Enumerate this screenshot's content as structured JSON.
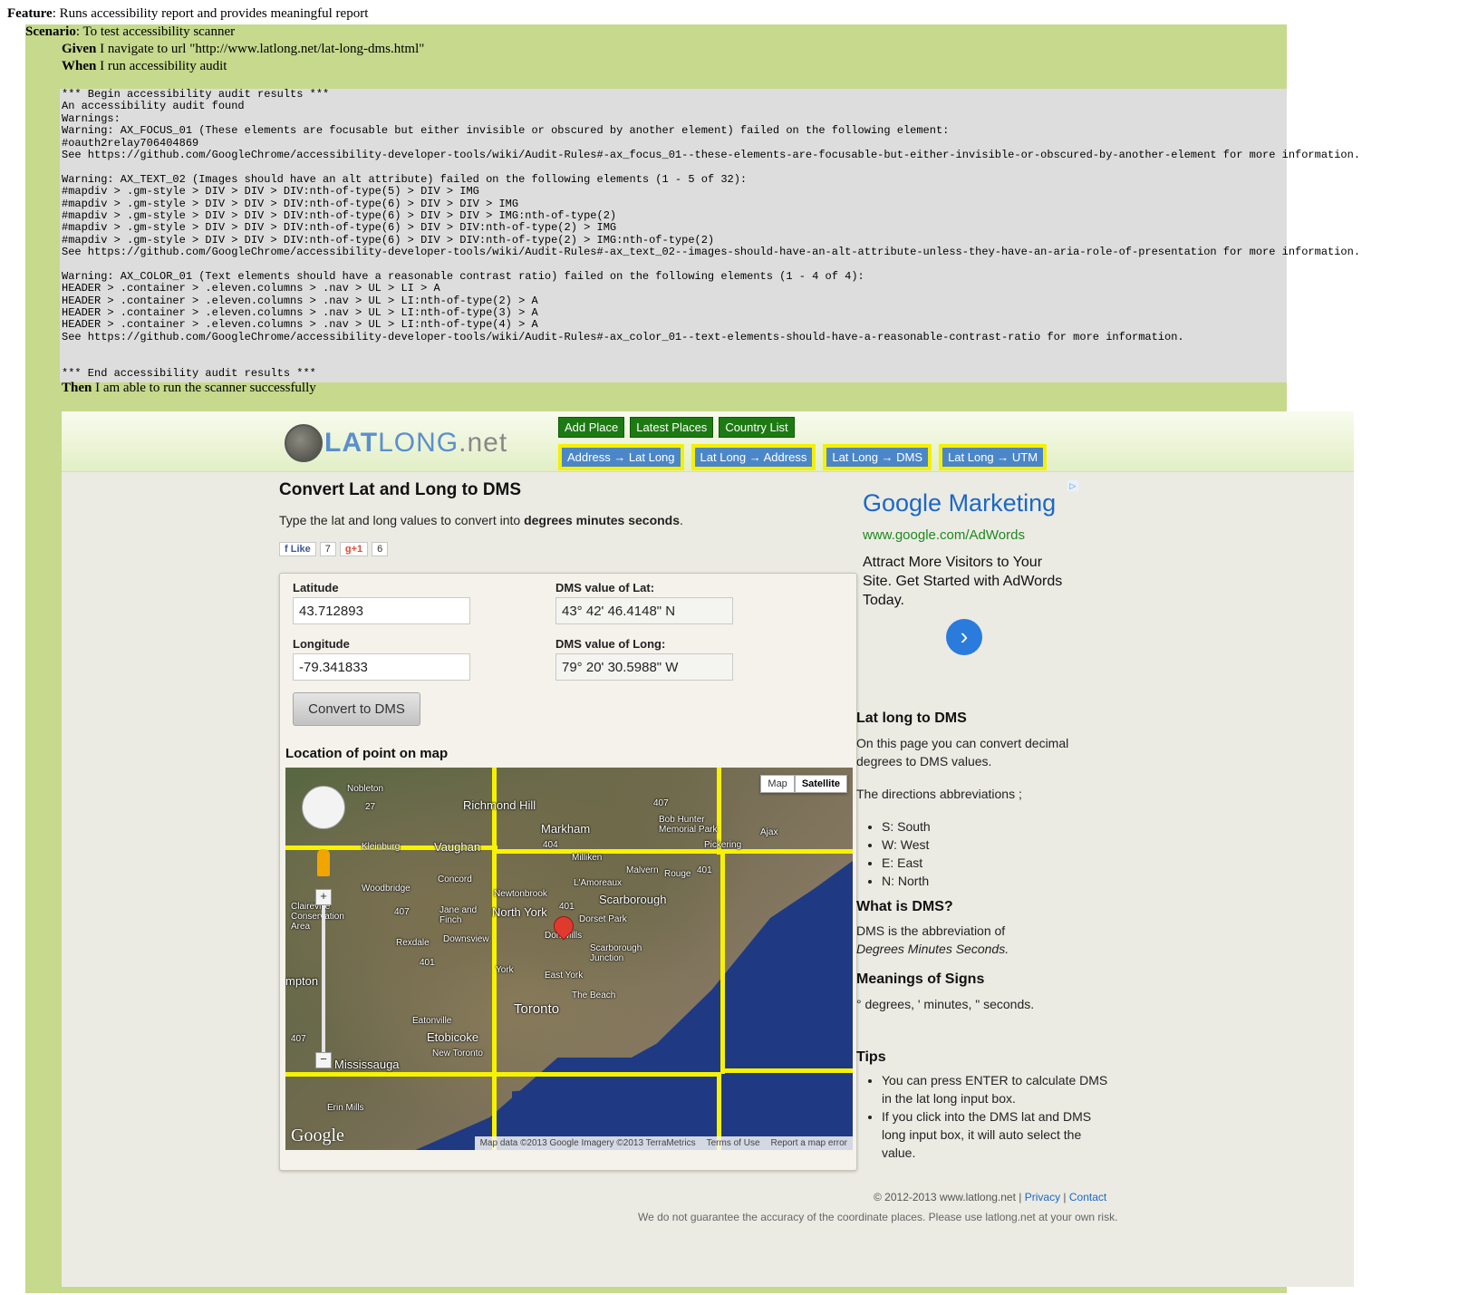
{
  "feature": {
    "keyword": "Feature",
    "text": ": Runs accessibility report and provides meaningful report"
  },
  "scenario": {
    "keyword": "Scenario",
    "text": ": To test accessibility scanner"
  },
  "steps": [
    {
      "keyword": "Given",
      "text": " I navigate to url \"http://www.latlong.net/lat-long-dms.html\""
    },
    {
      "keyword": "When",
      "text": " I run accessibility audit"
    },
    {
      "keyword": "Then",
      "text": " I am able to run the scanner successfully"
    }
  ],
  "audit": {
    "lines": [
      "*** Begin accessibility audit results ***",
      "An accessibility audit found",
      "Warnings:",
      "Warning: AX_FOCUS_01 (These elements are focusable but either invisible or obscured by another element) failed on the following element:",
      "#oauth2relay706404869",
      "See https://github.com/GoogleChrome/accessibility-developer-tools/wiki/Audit-Rules#-ax_focus_01--these-elements-are-focusable-but-either-invisible-or-obscured-by-another-element for more information.",
      "",
      "Warning: AX_TEXT_02 (Images should have an alt attribute) failed on the following elements (1 - 5 of 32):",
      "#mapdiv > .gm-style > DIV > DIV > DIV:nth-of-type(5) > DIV > IMG",
      "#mapdiv > .gm-style > DIV > DIV > DIV:nth-of-type(6) > DIV > DIV > IMG",
      "#mapdiv > .gm-style > DIV > DIV > DIV:nth-of-type(6) > DIV > DIV > IMG:nth-of-type(2)",
      "#mapdiv > .gm-style > DIV > DIV > DIV:nth-of-type(6) > DIV > DIV:nth-of-type(2) > IMG",
      "#mapdiv > .gm-style > DIV > DIV > DIV:nth-of-type(6) > DIV > DIV:nth-of-type(2) > IMG:nth-of-type(2)",
      "See https://github.com/GoogleChrome/accessibility-developer-tools/wiki/Audit-Rules#-ax_text_02--images-should-have-an-alt-attribute-unless-they-have-an-aria-role-of-presentation for more information.",
      "",
      "Warning: AX_COLOR_01 (Text elements should have a reasonable contrast ratio) failed on the following elements (1 - 4 of 4):",
      "HEADER > .container > .eleven.columns > .nav > UL > LI > A",
      "HEADER > .container > .eleven.columns > .nav > UL > LI:nth-of-type(2) > A",
      "HEADER > .container > .eleven.columns > .nav > UL > LI:nth-of-type(3) > A",
      "HEADER > .container > .eleven.columns > .nav > UL > LI:nth-of-type(4) > A",
      "See https://github.com/GoogleChrome/accessibility-developer-tools/wiki/Audit-Rules#-ax_color_01--text-elements-should-have-a-reasonable-contrast-ratio for more information.",
      "",
      "",
      "*** End accessibility audit results ***"
    ]
  },
  "site": {
    "logo": {
      "lat": "LAT",
      "long": "LONG",
      "net": ".net"
    },
    "nav_top": [
      "Add Place",
      "Latest Places",
      "Country List"
    ],
    "nav_bottom": [
      "Address → Lat Long",
      "Lat Long → Address",
      "Lat Long → DMS",
      "Lat Long → UTM"
    ],
    "title": "Convert Lat and Long to DMS",
    "subtitle_pre": "Type the lat and long values to convert into ",
    "subtitle_bold": "degrees minutes seconds",
    "subtitle_post": ".",
    "social": {
      "fb_label": "Like",
      "fb_count": "7",
      "gplus_label": "+1",
      "gplus_count": "6"
    },
    "form": {
      "lat_label": "Latitude",
      "lat_value": "43.712893",
      "lng_label": "Longitude",
      "lng_value": "-79.341833",
      "dms_lat_label": "DMS value of Lat:",
      "dms_lat_value": "43° 42' 46.4148\" N",
      "dms_lng_label": "DMS value of Long:",
      "dms_lng_value": "79° 20' 30.5988\" W",
      "convert_label": "Convert to DMS"
    },
    "map": {
      "title": "Location of point on map",
      "type_map": "Map",
      "type_satellite": "Satellite",
      "places": [
        "Nobleton",
        "Richmond Hill",
        "Markham",
        "Bob Hunter Memorial Park",
        "Kleinburg",
        "Vaughan",
        "Pickering",
        "Ajax",
        "Woodbridge",
        "Concord",
        "Milliken",
        "Malvern",
        "Rouge",
        "L'Amoreaux",
        "Newtonbrook",
        "Scarborough",
        "Claireville Conservation Area",
        "Jane and Finch",
        "North York",
        "Dorset Park",
        "Rexdale",
        "Downsview",
        "Don Mills",
        "Scarborough Junction",
        "York",
        "East York",
        "mpton",
        "The Beach",
        "Toronto",
        "Eatonville",
        "Etobicoke",
        "New Toronto",
        "Mississauga",
        "Erin Mills"
      ],
      "route_labels": [
        "27",
        "407",
        "404",
        "401",
        "407",
        "401",
        "407",
        "401"
      ],
      "google_logo": "Google",
      "attribution": "Map data ©2013 Google Imagery ©2013 TerraMetrics",
      "terms": "Terms of Use",
      "report": "Report a map error"
    },
    "ad": {
      "title": "Google Marketing",
      "url": "www.google.com/AdWords",
      "body": "Attract More Visitors to Your Site. Get Started with AdWords Today.",
      "arrow": "›",
      "badge": "▷"
    },
    "sidebar": {
      "h1": "Lat long to DMS",
      "p1": "On this page you can convert decimal degrees to DMS values.",
      "p2": "The directions abbreviations ;",
      "dirs": [
        "S: South",
        "W: West",
        "E: East",
        "N: North"
      ],
      "h2": "What is DMS?",
      "p3_pre": "DMS is the abbreviation of ",
      "p3_em": "Degrees Minutes Seconds.",
      "h3": "Meanings of Signs",
      "p4": "° degrees, ' minutes, \" seconds.",
      "h4": "Tips",
      "tips": [
        "You can press ENTER to calculate DMS in the lat long input box.",
        "If you click into the DMS lat and DMS long input box, it will auto select the value."
      ]
    },
    "footer": {
      "copyright": "© 2012-2013 www.latlong.net | ",
      "privacy": "Privacy",
      "sep": " | ",
      "contact": "Contact",
      "disclaimer": "We do not guarantee the accuracy of the coordinate places. Please use latlong.net at your own risk."
    }
  }
}
